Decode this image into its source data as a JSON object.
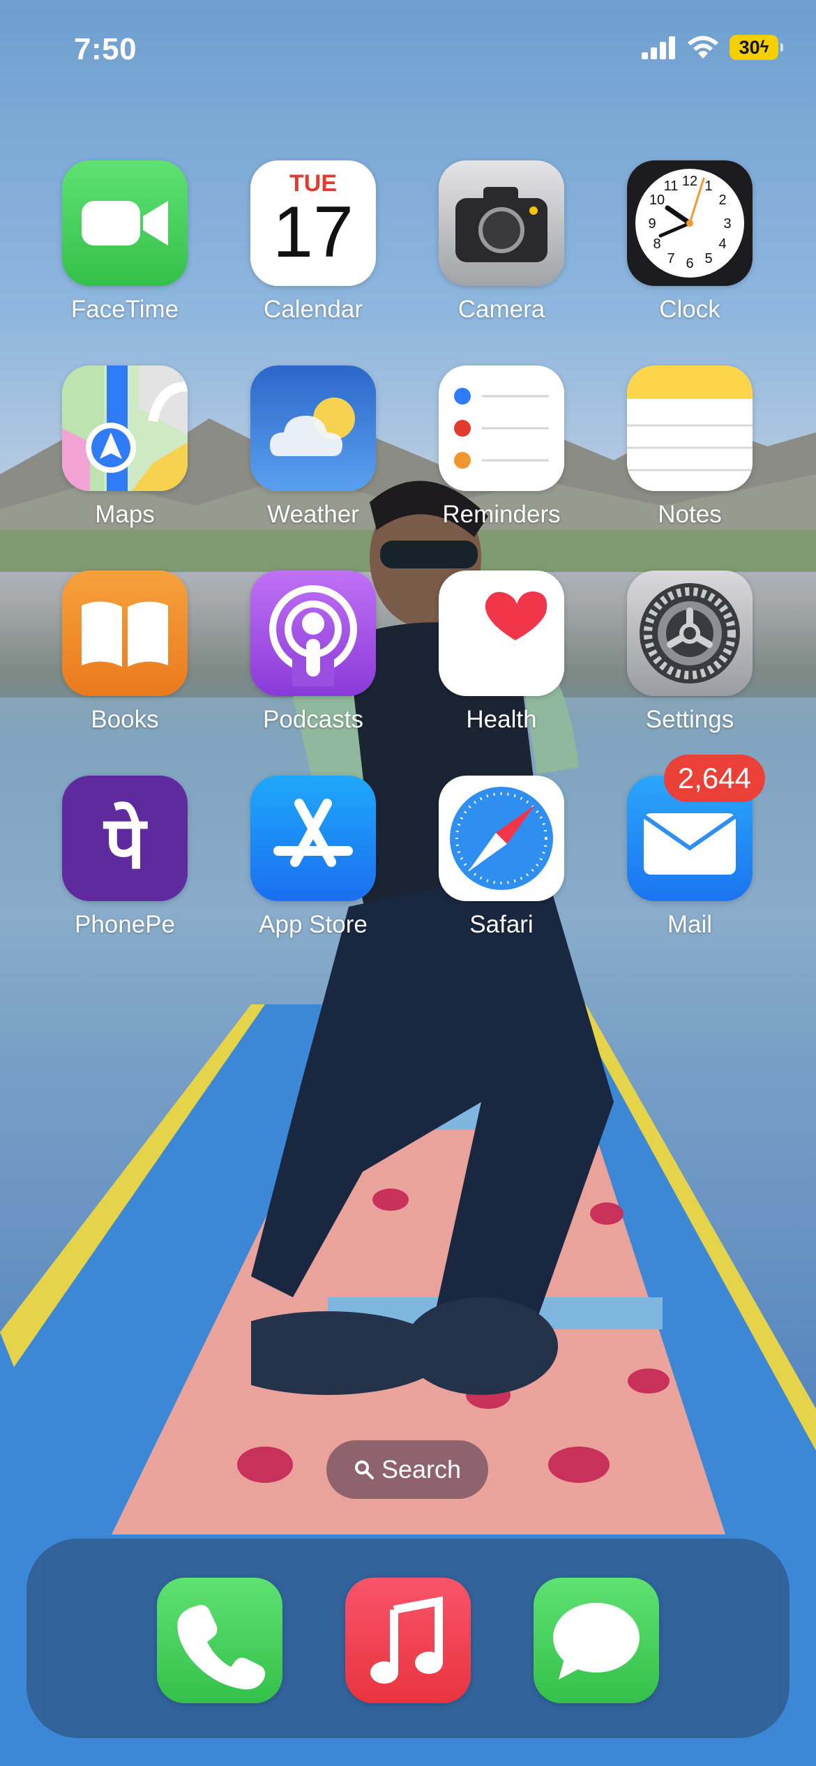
{
  "status_bar": {
    "time": "7:50",
    "battery_level": "30"
  },
  "home_screen": {
    "apps": [
      {
        "label": "FaceTime"
      },
      {
        "label": "Calendar",
        "weekday": "TUE",
        "day": "17"
      },
      {
        "label": "Camera"
      },
      {
        "label": "Clock",
        "numerals": [
          "12",
          "1",
          "2",
          "3",
          "4",
          "5",
          "6",
          "7",
          "8",
          "9",
          "10",
          "11"
        ]
      },
      {
        "label": "Maps"
      },
      {
        "label": "Weather"
      },
      {
        "label": "Reminders"
      },
      {
        "label": "Notes"
      },
      {
        "label": "Books"
      },
      {
        "label": "Podcasts"
      },
      {
        "label": "Health"
      },
      {
        "label": "Settings"
      },
      {
        "label": "PhonePe",
        "glyph": "पे"
      },
      {
        "label": "App Store"
      },
      {
        "label": "Safari"
      },
      {
        "label": "Mail",
        "badge": "2,644"
      }
    ],
    "search_label": "Search"
  },
  "dock": {
    "apps": [
      "phone",
      "music",
      "messages"
    ]
  },
  "colors": {
    "facetime_green": "#4ed863",
    "calendar_red": "#e23a2f",
    "notes_yellow": "#fdd54a",
    "podcasts_purple": "#9b4fe0",
    "phonepe_purple": "#5f2a9e",
    "appstore_blue": "#1b8cf5",
    "badge_red": "#eb4038",
    "battery_yellow": "#f5d000"
  }
}
